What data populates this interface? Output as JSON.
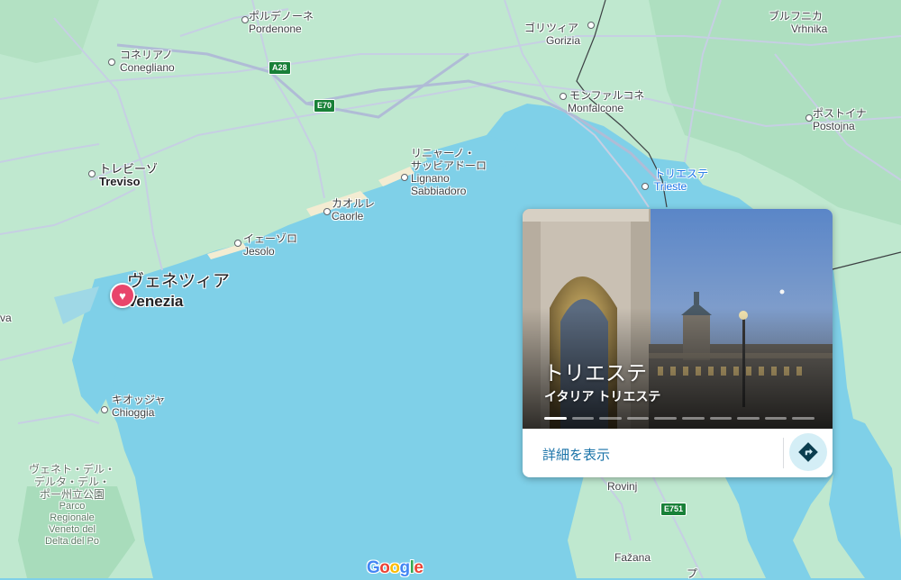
{
  "map": {
    "colors": {
      "sea": "#7fd0e8",
      "land": "#bfe8cf",
      "land_dark": "#a8dcbb",
      "road": "#c9d3e6",
      "border": "#3c4043"
    },
    "places": [
      {
        "id": "pordenone",
        "ja": "ポルデノーネ",
        "en": "Pordenone"
      },
      {
        "id": "conegliano",
        "ja": "コネリアノ",
        "en": "Conegliano"
      },
      {
        "id": "treviso",
        "ja": "トレビーゾ",
        "en": "Treviso"
      },
      {
        "id": "gorizia",
        "ja": "ゴリツィア",
        "en": "Gorizia"
      },
      {
        "id": "vrhnika",
        "ja": "ブルフニカ",
        "en": "Vrhnika"
      },
      {
        "id": "monfalcone",
        "ja": "モンファルコネ",
        "en": "Monfalcone"
      },
      {
        "id": "postojna",
        "ja": "ポストイナ",
        "en": "Postojna"
      },
      {
        "id": "lignano",
        "ja": "リニャーノ・サッビアドーロ",
        "ja_line1": "リニャーノ・",
        "ja_line2": "サッビアドーロ",
        "en_line1": "Lignano",
        "en_line2": "Sabbiadoro"
      },
      {
        "id": "caorle",
        "ja": "カオルレ",
        "en": "Caorle"
      },
      {
        "id": "jesolo",
        "ja": "イェーゾロ",
        "en": "Jesolo"
      },
      {
        "id": "venezia",
        "ja": "ヴェネツィア",
        "en": "Venezia"
      },
      {
        "id": "chioggia",
        "ja": "キオッジャ",
        "en": "Chioggia"
      },
      {
        "id": "trieste",
        "ja": "トリエステ",
        "en": "Trieste"
      },
      {
        "id": "rovinj",
        "ja": "",
        "en": "Rovinj"
      },
      {
        "id": "fazana",
        "ja": "",
        "en": "Fažana"
      },
      {
        "id": "wa",
        "ja": "",
        "en": "va"
      }
    ],
    "park": {
      "ja_line1": "ヴェネト・デル・",
      "ja_line2": "デルタ・デル・",
      "ja_line3": "ポー州立公園",
      "en_line1": "Parco",
      "en_line2": "Regionale",
      "en_line3": "Veneto del",
      "en_line4": "Delta del Po"
    },
    "shields": {
      "a28": "A28",
      "e70": "E70",
      "e751": "E751"
    },
    "partial_label": "プ",
    "logo": "Google"
  },
  "card": {
    "title": "トリエステ",
    "subtitle": "イタリア トリエステ",
    "details_label": "詳細を表示",
    "photo_count": 10,
    "active_photo": 1,
    "directions_icon": "directions-icon"
  }
}
